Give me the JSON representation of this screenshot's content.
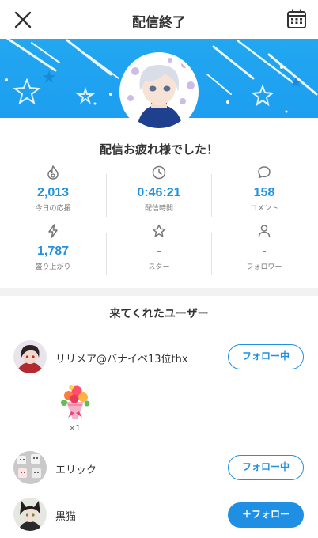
{
  "header": {
    "title": "配信終了",
    "close_icon": "close-icon",
    "calendar_icon": "calendar-icon"
  },
  "banner": {
    "color": "#22a7f0"
  },
  "message": "配信お疲れ様でした！",
  "stats": [
    {
      "icon": "flame-icon",
      "value": "2,013",
      "label": "今日の応援"
    },
    {
      "icon": "clock-icon",
      "value": "0:46:21",
      "label": "配信時間"
    },
    {
      "icon": "comment-icon",
      "value": "158",
      "label": "コメント"
    },
    {
      "icon": "lightning-icon",
      "value": "1,787",
      "label": "盛り上がり"
    },
    {
      "icon": "star-icon",
      "value": "-",
      "label": "スター"
    },
    {
      "icon": "person-icon",
      "value": "-",
      "label": "フォロワー"
    }
  ],
  "visitors": {
    "title": "来てくれたユーザー",
    "users": [
      {
        "name": "リリメア@バナイベ13位thx",
        "button": "フォロー中",
        "gift_count": "×1"
      },
      {
        "name": "エリック",
        "button": "フォロー中"
      },
      {
        "name": "黒猫",
        "button": "＋フォロー"
      }
    ]
  },
  "colors": {
    "accent": "#2291de",
    "primary_button": "#1f8fe3"
  }
}
